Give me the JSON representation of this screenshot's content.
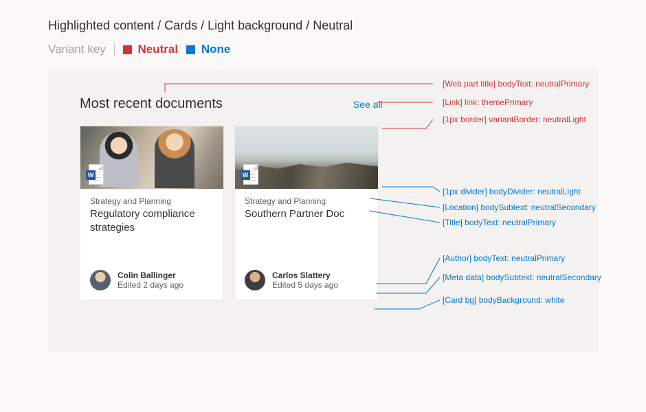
{
  "page_title": "Highlighted content / Cards / Light background / Neutral",
  "variant": {
    "label": "Variant key",
    "neutral": "Neutral",
    "none": "None"
  },
  "section": {
    "title": "Most recent documents",
    "see_all": "See all"
  },
  "cards": [
    {
      "location": "Strategy and Planning",
      "title": "Regulatory compliance strategies",
      "author": "Colin Ballinger",
      "meta": "Edited 2 days ago"
    },
    {
      "location": "Strategy and Planning",
      "title": "Southern Partner Doc",
      "author": "Carlos Slattery",
      "meta": "Edited 5 days ago"
    }
  ],
  "callouts": {
    "webpart_title": "[Web part title] bodyText: neutralPrimary",
    "link": "[Link] link: themePrimary",
    "border": "[1px border] variantBorder: neutralLight",
    "divider": "[1px divider] bodyDivider: neutralLight",
    "location": "[Location] bodySubtext: neutralSecondary",
    "title": "[Title] bodyText: neutralPrimary",
    "author": "[Author] bodyText: neutralPrimary",
    "meta": "[Meta data] bodySubtext: neutralSecondary",
    "cardbg": "[Card bg] bodyBackground: white"
  },
  "colors": {
    "neutralPrimary": "#323130",
    "neutralSecondary": "#605e5c",
    "neutralLight": "#edebe9",
    "themePrimary": "#0078d4",
    "white": "#ffffff",
    "red": "#d13438"
  }
}
